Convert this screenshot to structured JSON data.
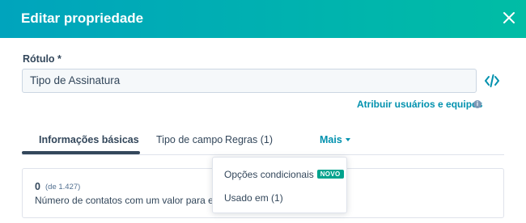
{
  "modal": {
    "title": "Editar propriedade"
  },
  "form": {
    "label": "Rótulo *",
    "value": "Tipo de Assinatura",
    "assign_link": "Atribuir usuários e equipes"
  },
  "tabs": [
    {
      "label": "Informações básicas",
      "active": true
    },
    {
      "label": "Tipo de campo",
      "active": false
    },
    {
      "label": "Regras (1)",
      "active": false
    },
    {
      "label": "Mais",
      "active": false
    }
  ],
  "card": {
    "count": "0",
    "total": "(de 1.427)",
    "description": "Número de contatos com um valor para essa"
  },
  "dropdown": {
    "items": [
      {
        "label": "Opções condicionais",
        "badge": "NOVO"
      },
      {
        "label": "Usado em (1)"
      }
    ]
  },
  "icons": {
    "close": "close-icon",
    "code": "code-icon",
    "info": "info-icon",
    "caret": "caret-down-icon"
  },
  "colors": {
    "header_start": "#00a4bd",
    "header_end": "#00bda5",
    "link": "#0091ae",
    "badge": "#00a38d",
    "text": "#33475b"
  }
}
